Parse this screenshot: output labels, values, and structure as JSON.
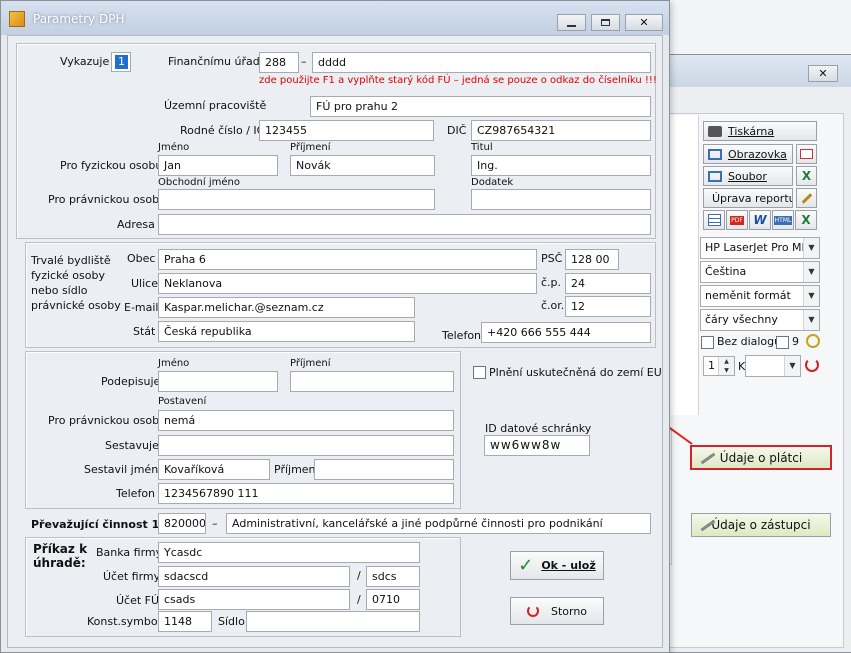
{
  "bg_window": {
    "close_glyph": "✕",
    "buttons": [
      {
        "label": "Tiskárna"
      },
      {
        "label": "Obrazovka"
      },
      {
        "label": "Soubor"
      },
      {
        "label": "Úprava reportu"
      }
    ],
    "format_icons": [
      "PDF",
      "W",
      "HTML",
      "X"
    ],
    "printer": "HP LaserJet Pro MFP",
    "language": "Čeština",
    "format": "neměnit formát",
    "lines": "čáry všechny",
    "no_dialog_label": "Bez dialogu",
    "nine_label": "9",
    "copies": "1",
    "k_label": "K",
    "udaje_platci": "Údaje o plátci",
    "udaje_zastupci": "Údaje o zástupci"
  },
  "dialog": {
    "title": "Parametry DPH",
    "vykazuje_label": "Vykazuje",
    "vykazuje_value": "1",
    "fu_label": "Finančnímu úřadu",
    "fu_code": "288",
    "fu_dash": "–",
    "fu_name": "dddd",
    "warning": "zde použijte F1 a vyplňte starý kód FÚ – jedná se pouze o odkaz do číselníku !!!",
    "up_label": "Územní pracoviště",
    "up_value": "FÚ pro prahu 2",
    "rc_label": "Rodné číslo / IČ",
    "rc_value": "123455",
    "dic_label": "DIČ",
    "dic_value": "CZ987654321",
    "jmeno_label": "Jméno",
    "prijmeni_label": "Příjmení",
    "titul_label": "Titul",
    "fo_label": "Pro fyzickou osobu",
    "fo_jmeno": "Jan",
    "fo_prijmeni": "Novák",
    "fo_titul": "Ing.",
    "obch_label": "Obchodní jméno",
    "dodatek_label": "Dodatek",
    "po_label": "Pro právnickou osobu",
    "po_obch": "",
    "po_dodatek": "",
    "adresa_label": "Adresa",
    "adresa_value": "",
    "trvale_label": "Trvalé bydliště fyzické osoby nebo sídlo právnické osoby",
    "obec_label": "Obec",
    "obec_value": "Praha 6",
    "psc_label": "PSČ",
    "psc_value": "128 00",
    "ulice_label": "Ulice",
    "ulice_value": "Neklanova",
    "cp_label": "č.p.",
    "cp_value": "24",
    "email_label": "E-mail",
    "email_value": "Kaspar.melichar.@seznam.cz",
    "cor_label": "č.or.",
    "cor_value": "12",
    "stat_label": "Stát",
    "stat_value": "Česká republika",
    "telefon_label": "Telefon",
    "telefon_value": "+420 666 555 444",
    "podepisuje_label": "Podepisuje",
    "podepisuje_jmeno": "",
    "podepisuje_prijmeni": "",
    "postaveni_label": "Postavení",
    "postaveni_value": "nemá",
    "sestavuje_label": "Sestavuje",
    "sestavuje_value": "",
    "sestavil_label": "Sestavil jméno",
    "sestavil_jmeno": "Kovaříková",
    "sestavil_prijmeni_label": "Příjmení",
    "sestavil_prijmeni": "",
    "telefon2_value": "1234567890 111",
    "eu_label": "Plnění uskutečněná do zemí EU",
    "ids_label": "ID datové schránky",
    "ids_value": "ww6ww8w",
    "cinnost_label": "Převažující činnost 1:",
    "cinnost_code": "820000",
    "cinnost_dash": "–",
    "cinnost_text": "Administrativní, kancelářské a jiné podpůrné činnosti pro podnikání",
    "prikaz_label": "Příkaz k úhradě:",
    "banka_label": "Banka firmy",
    "banka_value": "Ycasdc",
    "ucet_label": "Účet firmy",
    "ucet_value": "sdacscd",
    "ucet_bank": "sdcs",
    "ucetfu_label": "Účet FÚ",
    "ucetfu_value": "csads",
    "ucetfu_bank": "0710",
    "slash": "/",
    "ks_label": "Konst.symbol",
    "ks_value": "1148",
    "sidlo_label": "Sídlo",
    "sidlo_value": "",
    "ok_label": "Ok - ulož",
    "storno_label": "Storno"
  }
}
